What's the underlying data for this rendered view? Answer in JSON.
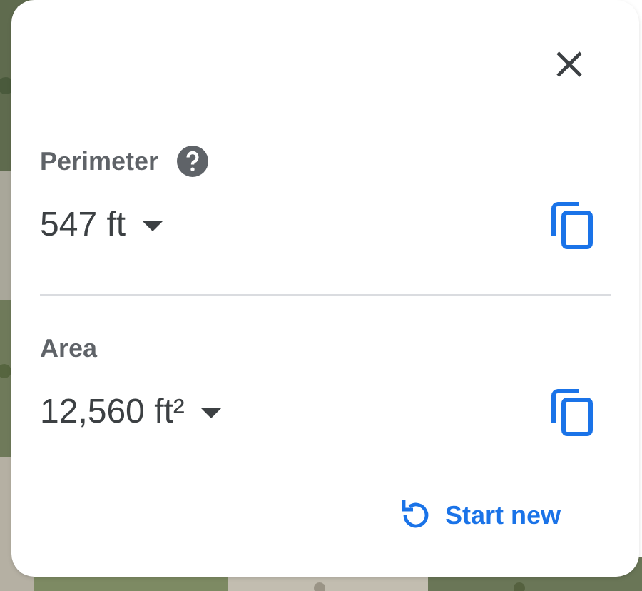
{
  "sections": [
    {
      "label": "Perimeter",
      "help": true,
      "value": "547 ft"
    },
    {
      "label": "Area",
      "help": false,
      "value": "12,560 ft²"
    }
  ],
  "start_new": "Start new"
}
